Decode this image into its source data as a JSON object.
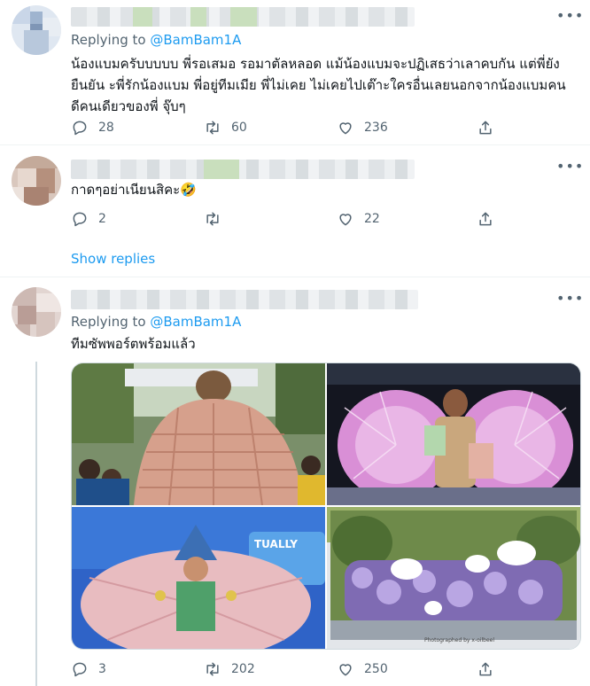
{
  "tweets": [
    {
      "replying_prefix": "Replying to",
      "replying_handle": "@BamBam1A",
      "text": "น้องแบมครับบบบบ  พี่รอเสมอ รอมาตัลหลอด แม้น้องแบมจะปฏิเสธว่าเลาคบกัน แต่พี่ยังยืนยัน ะพี่รักน้องแบม พี่อยู่ทีมเมีย พี่ไม่เคย ไม่เคยไปเต๊าะใครอื่นเลยนอกจากน้องแบมคนดีคนเดียวของพี่ จุ๊บๆ",
      "counts": {
        "replies": "28",
        "retweets": "60",
        "likes": "236"
      }
    },
    {
      "text": "กาดๆอย่าเนียนสิคะ🤣",
      "counts": {
        "replies": "2",
        "retweets": "",
        "likes": "22"
      },
      "show_replies": "Show replies"
    },
    {
      "replying_prefix": "Replying to",
      "replying_handle": "@BamBam1A",
      "text": "ทีมซัพพอร์ตพร้อมแล้ว",
      "counts": {
        "replies": "3",
        "retweets": "202",
        "likes": "250"
      },
      "images": [
        {
          "name": "money-cape-crowd-photo"
        },
        {
          "name": "pink-money-wings-stage-photo"
        },
        {
          "name": "money-costume-stage-photo",
          "overlay_text": "TUALLY"
        },
        {
          "name": "flower-float-photo",
          "overlay_text": "Photographed by x-oilbeel"
        }
      ]
    }
  ],
  "more_icon": "more-horizontal-icon",
  "colors": {
    "accent": "#1d9bf0",
    "muted": "#536471",
    "text": "#0f1419",
    "border": "#eff3f4"
  }
}
